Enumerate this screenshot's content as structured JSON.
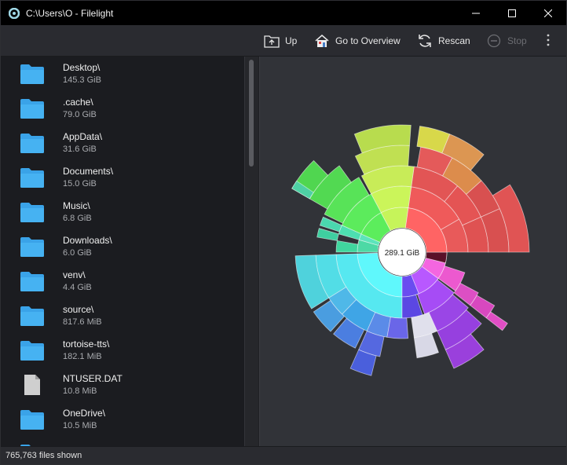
{
  "window": {
    "title": "C:\\Users\\O - Filelight"
  },
  "toolbar": {
    "up_label": "Up",
    "overview_label": "Go to Overview",
    "rescan_label": "Rescan",
    "stop_label": "Stop"
  },
  "files": [
    {
      "name": "Desktop\\",
      "size": "145.3 GiB",
      "type": "folder"
    },
    {
      "name": ".cache\\",
      "size": "79.0 GiB",
      "type": "folder"
    },
    {
      "name": "AppData\\",
      "size": "31.6 GiB",
      "type": "folder"
    },
    {
      "name": "Documents\\",
      "size": "15.0 GiB",
      "type": "folder"
    },
    {
      "name": "Music\\",
      "size": "6.8 GiB",
      "type": "folder"
    },
    {
      "name": "Downloads\\",
      "size": "6.0 GiB",
      "type": "folder"
    },
    {
      "name": "venv\\",
      "size": "4.4 GiB",
      "type": "folder"
    },
    {
      "name": "source\\",
      "size": "817.6 MiB",
      "type": "folder"
    },
    {
      "name": "tortoise-tts\\",
      "size": "182.1 MiB",
      "type": "folder"
    },
    {
      "name": "NTUSER.DAT",
      "size": "10.8 MiB",
      "type": "file"
    },
    {
      "name": "OneDrive\\",
      "size": "10.5 MiB",
      "type": "folder"
    },
    {
      "name": "",
      "size": "",
      "type": "folder"
    }
  ],
  "map": {
    "center_label": "289.1 GiB",
    "colors": {
      "desktop": "#ff6a6a",
      "cache": "#55ffff",
      "appdata": "#b44dff",
      "documents": "#c8ff46",
      "music": "#64ff64"
    }
  },
  "status": {
    "text": "765,763 files shown"
  }
}
